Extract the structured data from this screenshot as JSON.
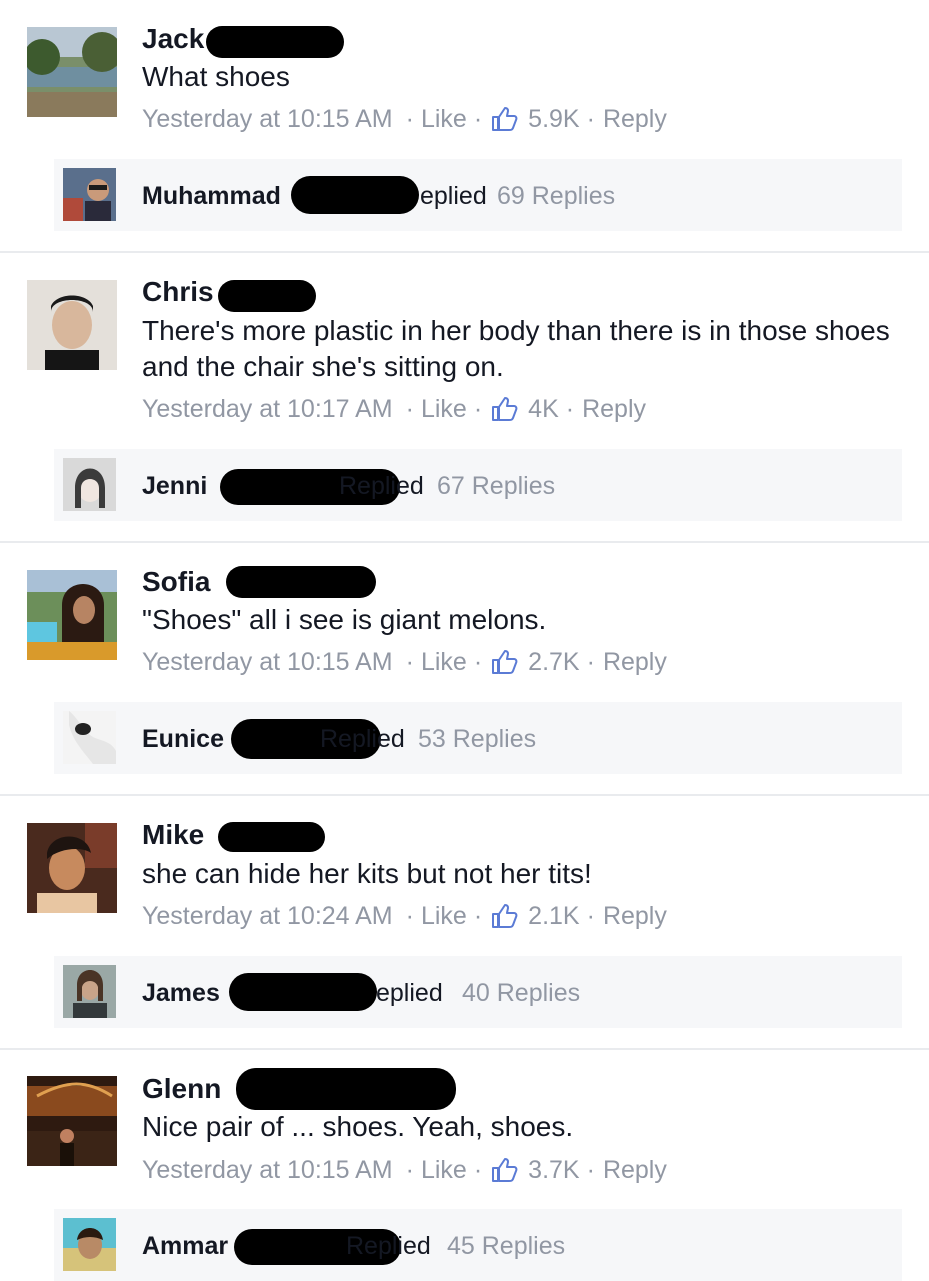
{
  "comments": [
    {
      "name": "Jack",
      "text": "What shoes",
      "time": "Yesterday at 10:15 AM",
      "like_label": "Like",
      "likes": "5.9K",
      "reply_label": "Reply",
      "reply": {
        "name": "Muhammad",
        "tail": "eplied",
        "count": "69 Replies"
      }
    },
    {
      "name": "Chris",
      "text": "There's more plastic in her body than there is in those shoes and the chair she's sitting on.",
      "time": "Yesterday at 10:17 AM",
      "like_label": "Like",
      "likes": "4K",
      "reply_label": "Reply",
      "reply": {
        "name": "Jenni",
        "tail": "Replied",
        "count": "67 Replies"
      }
    },
    {
      "name": "Sofia",
      "text": "\"Shoes\" all i see is giant melons.",
      "time": "Yesterday at 10:15 AM",
      "like_label": "Like",
      "likes": "2.7K",
      "reply_label": "Reply",
      "reply": {
        "name": "Eunice",
        "tail": "Replied",
        "count": "53 Replies"
      }
    },
    {
      "name": "Mike",
      "text": "she can hide her kits but not her tits!",
      "time": "Yesterday at 10:24 AM",
      "like_label": "Like",
      "likes": "2.1K",
      "reply_label": "Reply",
      "reply": {
        "name": "James",
        "tail": "eplied",
        "count": "40 Replies"
      }
    },
    {
      "name": "Glenn",
      "text": "Nice pair of ... shoes. Yeah, shoes.",
      "time": "Yesterday at 10:15 AM",
      "like_label": "Like",
      "likes": "3.7K",
      "reply_label": "Reply",
      "reply": {
        "name": "Ammar",
        "tail": "Replied",
        "count": "45 Replies"
      }
    }
  ],
  "colors": {
    "text": "#141823",
    "meta": "#9197a3",
    "like_icon": "#5b7bd5",
    "reply_bar": "#f6f7f9",
    "divider": "#e9ebee"
  }
}
